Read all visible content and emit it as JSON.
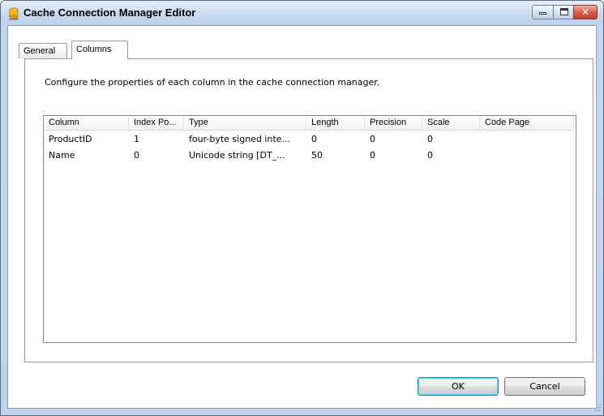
{
  "window": {
    "title": "Cache Connection Manager Editor",
    "close_glyph": "✕"
  },
  "tabs": [
    {
      "label": "General",
      "active": false
    },
    {
      "label": "Columns",
      "active": true
    }
  ],
  "instruction": "Configure the properties of each column in the cache connection manager.",
  "grid": {
    "headers": [
      "Column",
      "Index Po...",
      "Type",
      "Length",
      "Precision",
      "Scale",
      "Code Page"
    ],
    "rows": [
      [
        "ProductID",
        "1",
        "four-byte signed inte...",
        "0",
        "0",
        "0",
        ""
      ],
      [
        "Name",
        "0",
        "Unicode string [DT_...",
        "50",
        "0",
        "0",
        ""
      ]
    ]
  },
  "buttons": {
    "ok": "OK",
    "cancel": "Cancel"
  }
}
